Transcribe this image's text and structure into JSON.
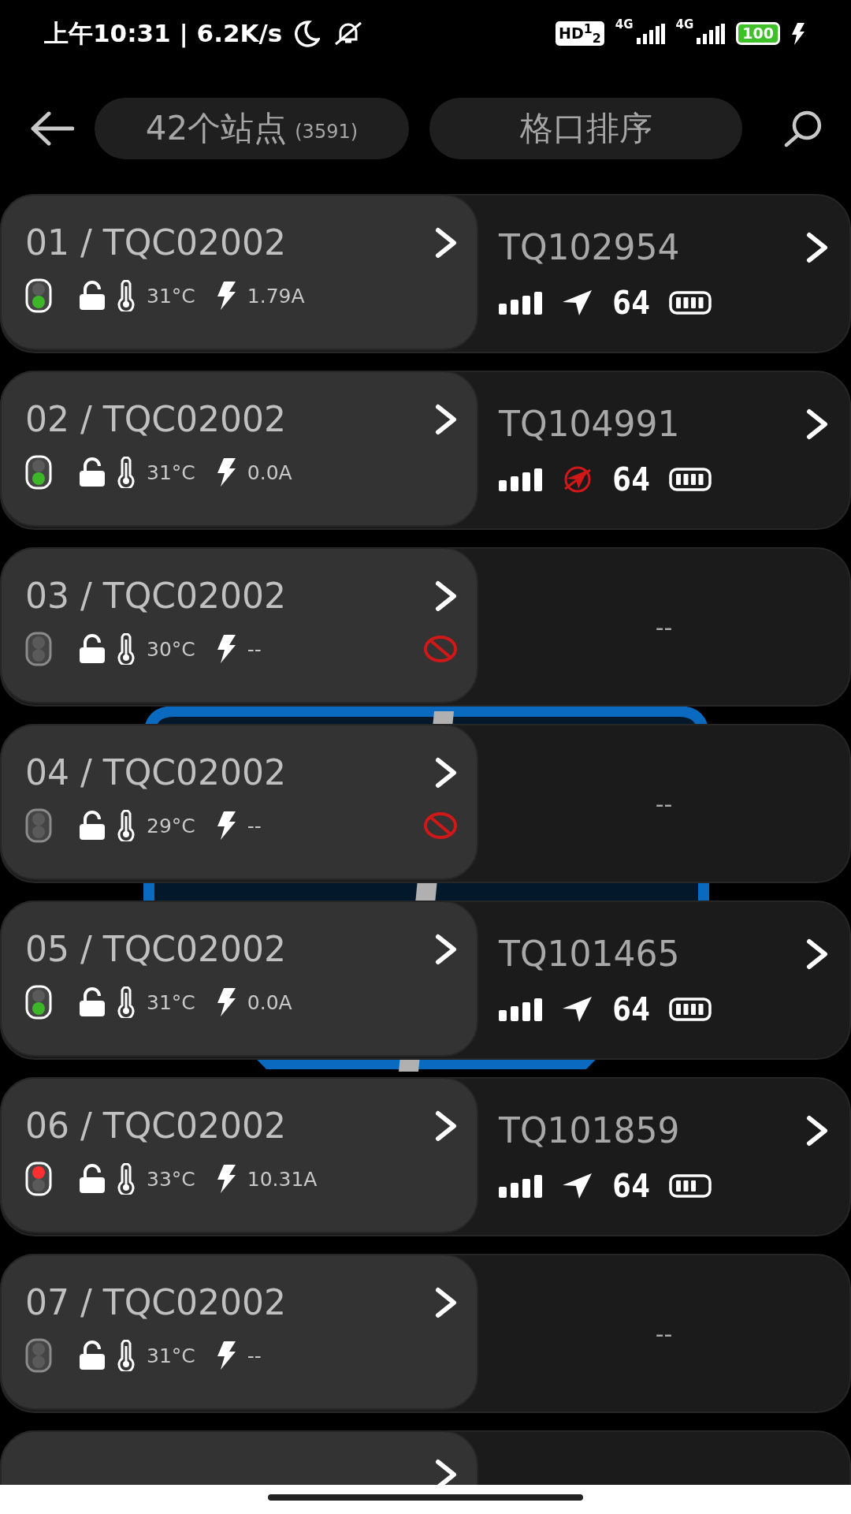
{
  "status_bar": {
    "time_speed": "上午10:31 | 6.2K/s",
    "hd_badge": "HD$^{1}$$_{2}$",
    "networks": [
      "4G",
      "4G"
    ],
    "battery": "100"
  },
  "header": {
    "stations": "42个站点",
    "station_count": "(3591)",
    "sort_button": "格口排序"
  },
  "rows": [
    {
      "title": "01 / TQC02002",
      "kind": "go",
      "color": "#3db62a",
      "temperature": "31°C",
      "current": "1.79A",
      "blocked": false,
      "device": {
        "id": "TQ102954",
        "gps_ok": true,
        "speed": "64",
        "battery_full": true
      }
    },
    {
      "title": "02 / TQC02002",
      "kind": "go",
      "color": "#3db62a",
      "temperature": "31°C",
      "current": "0.0A",
      "blocked": false,
      "device": {
        "id": "TQ104991",
        "gps_ok": false,
        "speed": "64",
        "battery_full": true
      }
    },
    {
      "title": "03 / TQC02002",
      "kind": "idle",
      "color": "#5a5a5a",
      "temperature": "30°C",
      "current": "--",
      "blocked": true,
      "empty_text": "--"
    },
    {
      "title": "04 / TQC02002",
      "kind": "idle",
      "color": "#5a5a5a",
      "temperature": "29°C",
      "current": "--",
      "blocked": true,
      "empty_text": "--"
    },
    {
      "title": "05 / TQC02002",
      "kind": "go",
      "color": "#3db62a",
      "temperature": "31°C",
      "current": "0.0A",
      "blocked": false,
      "device": {
        "id": "TQ101465",
        "gps_ok": true,
        "speed": "64",
        "battery_full": true
      }
    },
    {
      "title": "06 / TQC02002",
      "kind": "stop",
      "color": "#ff3030",
      "temperature": "33°C",
      "current": "10.31A",
      "blocked": false,
      "device": {
        "id": "TQ101859",
        "gps_ok": true,
        "speed": "64",
        "battery_full": false
      }
    },
    {
      "title": "07 / TQC02002",
      "kind": "idle",
      "color": "#5a5a5a",
      "temperature": "31°C",
      "current": "--",
      "blocked": false,
      "empty_text": "--"
    }
  ],
  "more_rows": true
}
